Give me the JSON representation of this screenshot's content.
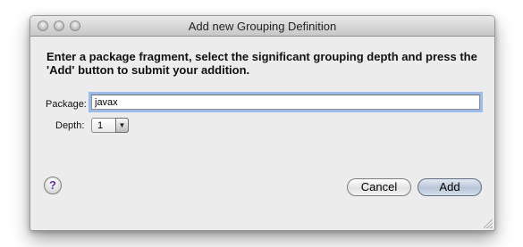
{
  "window": {
    "title": "Add new Grouping Definition"
  },
  "instruction": "Enter a package fragment, select the significant grouping depth and press the 'Add' button to submit your addition.",
  "form": {
    "package_label": "Package:",
    "package_value": "javax",
    "depth_label": "Depth:",
    "depth_value": "1"
  },
  "buttons": {
    "help_label": "?",
    "cancel_label": "Cancel",
    "add_label": "Add"
  },
  "icons": {
    "window_controls": [
      "close-icon",
      "minimize-icon",
      "zoom-icon"
    ],
    "depth_dropdown": "chevron-down-icon",
    "help": "help-icon"
  }
}
